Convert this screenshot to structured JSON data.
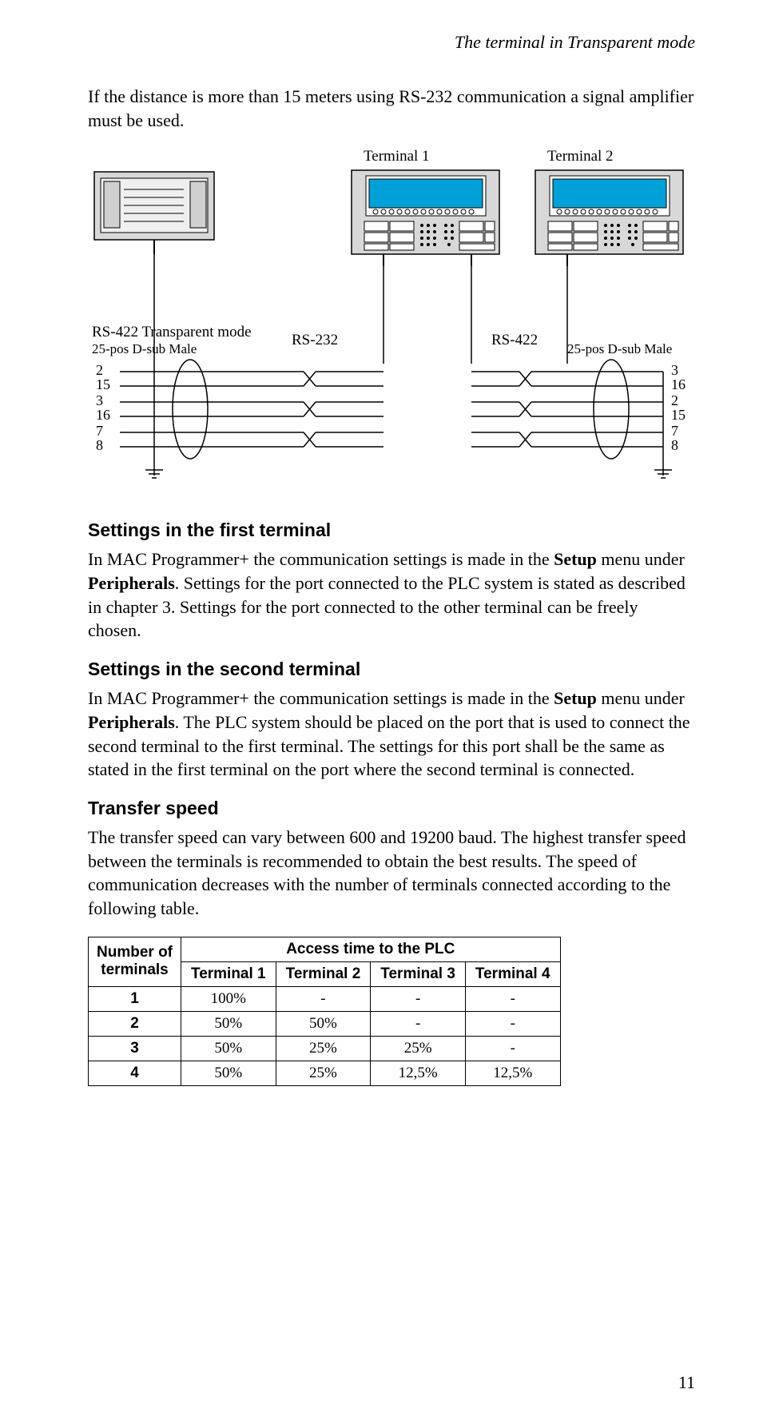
{
  "header": {
    "running_title": "The terminal in Transparent mode"
  },
  "intro": "If the distance is more than 15 meters using RS-232 communication a signal amplifier must be used.",
  "diagram": {
    "terminal1": "Terminal 1",
    "terminal2": "Terminal 2",
    "left_label": "RS-422 Transparent mode",
    "left_sublabel": "25-pos D-sub Male",
    "rs232": "RS-232",
    "rs422": "RS-422",
    "right_sublabel": "25-pos D-sub Male",
    "left_pins": [
      "2",
      "15",
      "3",
      "16",
      "7",
      "8"
    ],
    "right_pins": [
      "3",
      "16",
      "2",
      "15",
      "7",
      "8"
    ]
  },
  "sections": {
    "s1_title": "Settings in the first terminal",
    "s1_body_a": "In MAC Programmer+ the communication settings is made in the ",
    "s1_body_b": "Setup",
    "s1_body_c": " menu under ",
    "s1_body_d": "Peripherals",
    "s1_body_e": ". Settings for the port connected to the PLC system is stated as described in chapter 3. Settings for the port connected to the other terminal can be freely chosen.",
    "s2_title": "Settings in the second terminal",
    "s2_body_a": "In MAC Programmer+ the communication settings is made in the ",
    "s2_body_b": "Setup",
    "s2_body_c": " menu under ",
    "s2_body_d": "Peripherals",
    "s2_body_e": ". The PLC system should be placed on the port that is used to connect the second terminal to the first terminal. The settings for this port shall be the same as stated in the first terminal on the port where the second terminal is connected.",
    "s3_title": "Transfer speed",
    "s3_body": "The transfer speed can vary between 600 and 19200 baud. The highest transfer speed between the terminals is recommended to obtain the best results. The speed of communication decreases with the number of terminals connected according to the following table."
  },
  "chart_data": {
    "type": "table",
    "row_header_top": "Number of",
    "row_header_bot": "terminals",
    "super_header": "Access time to the PLC",
    "col_headers": [
      "Terminal 1",
      "Terminal 2",
      "Terminal 3",
      "Terminal 4"
    ],
    "rows": [
      {
        "n": "1",
        "vals": [
          "100%",
          "-",
          "-",
          "-"
        ]
      },
      {
        "n": "2",
        "vals": [
          "50%",
          "50%",
          "-",
          "-"
        ]
      },
      {
        "n": "3",
        "vals": [
          "50%",
          "25%",
          "25%",
          "-"
        ]
      },
      {
        "n": "4",
        "vals": [
          "50%",
          "25%",
          "12,5%",
          "12,5%"
        ]
      }
    ]
  },
  "page_number": "11"
}
